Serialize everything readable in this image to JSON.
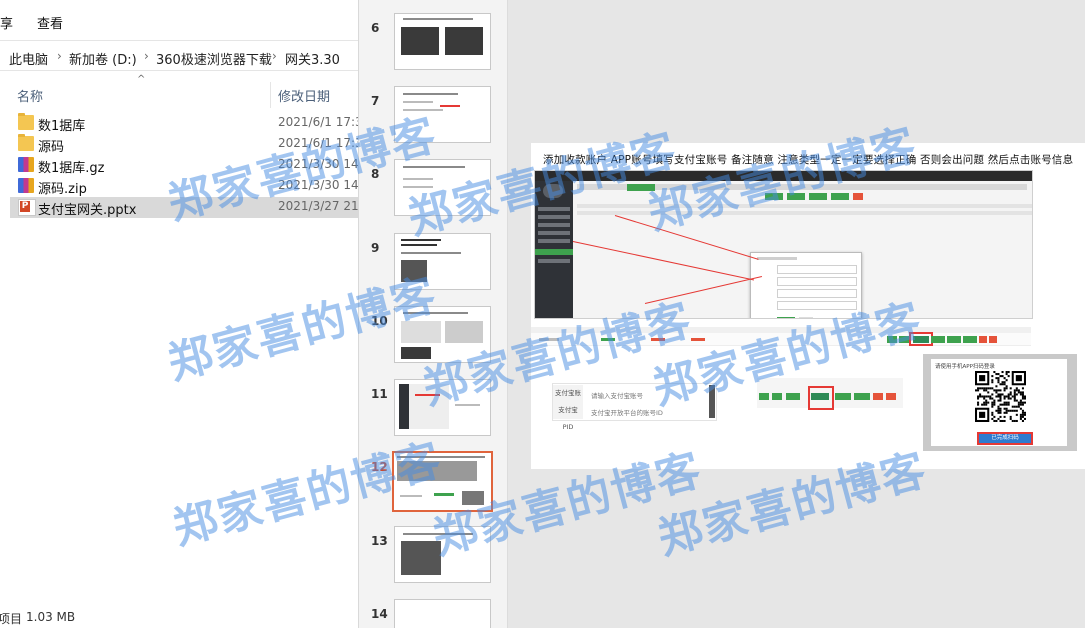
{
  "explorer": {
    "ribbon_tabs": [
      "享",
      "查看"
    ],
    "breadcrumb": [
      "此电脑",
      "新加卷 (D:)",
      "360极速浏览器下载",
      "网关3.30"
    ],
    "columns": {
      "name": "名称",
      "date": "修改日期"
    },
    "files": [
      {
        "name": "数1据库",
        "date": "2021/6/1 17:3",
        "type": "folder"
      },
      {
        "name": "源码",
        "date": "2021/6/1 17:3",
        "type": "folder"
      },
      {
        "name": "数1据库.gz",
        "date": "2021/3/30 14:",
        "type": "archive"
      },
      {
        "name": "源码.zip",
        "date": "2021/3/30 14:",
        "type": "archive"
      },
      {
        "name": "支付宝网关.pptx",
        "date": "2021/3/27 21:",
        "type": "pptx",
        "selected": true
      }
    ],
    "status": {
      "selected_label": "项目",
      "size": "1.03 MB"
    }
  },
  "thumbnails": {
    "slides": [
      {
        "number": "6"
      },
      {
        "number": "7"
      },
      {
        "number": "8"
      },
      {
        "number": "9"
      },
      {
        "number": "10"
      },
      {
        "number": "11"
      },
      {
        "number": "12",
        "active": true
      },
      {
        "number": "13"
      },
      {
        "number": "14"
      }
    ]
  },
  "slide": {
    "caption": "添加收款账户  APP账号填写支付宝账号 备注随意 注意类型一定一定要选择正确 否则会出问题 然后点击账号信息",
    "form": {
      "rows": [
        {
          "label": "支付宝账号",
          "value": "请输入支付宝账号"
        },
        {
          "label": "支付宝PID",
          "value": "支付宝开放平台的账号ID"
        }
      ]
    },
    "qr": {
      "title": "请使用手机APP扫码登录",
      "button": "已完成扫码"
    }
  },
  "watermark": {
    "text": "郑家喜的博客"
  },
  "colors": {
    "accent_green": "#3ea24e",
    "highlight_red": "#e53935",
    "active_thumb": "#d24726",
    "watermark": "#468ce1"
  }
}
